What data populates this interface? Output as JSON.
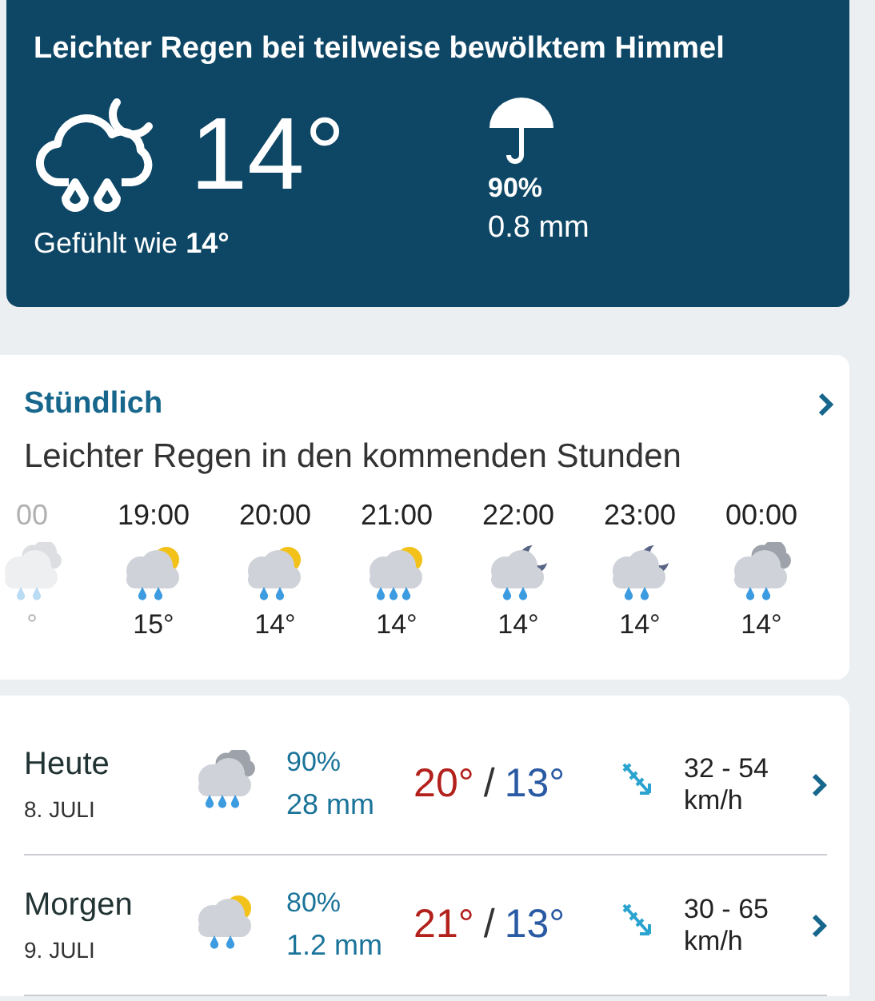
{
  "current": {
    "condition": "Leichter Regen bei teilweise bewölktem Himmel",
    "kind": "moon-rain",
    "temperature": "14°",
    "feels_like_label": "Gefühlt wie",
    "feels_like_value": "14°",
    "precip_chance": "90%",
    "precip_amount": "0.8 mm"
  },
  "hourly": {
    "title": "Stündlich",
    "summary": "Leichter Regen in den kommenden Stunden",
    "hours": [
      {
        "time": "00",
        "kind": "cloud-rain",
        "temp": "°",
        "partial": true
      },
      {
        "time": "19:00",
        "kind": "sun-rain",
        "temp": "15°",
        "partial": false
      },
      {
        "time": "20:00",
        "kind": "sun-rain",
        "temp": "14°",
        "partial": false
      },
      {
        "time": "21:00",
        "kind": "sun-heavy-rain",
        "temp": "14°",
        "partial": false
      },
      {
        "time": "22:00",
        "kind": "moon-rain",
        "temp": "14°",
        "partial": false
      },
      {
        "time": "23:00",
        "kind": "moon-rain",
        "temp": "14°",
        "partial": false
      },
      {
        "time": "00:00",
        "kind": "cloud-rain",
        "temp": "14°",
        "partial": false
      }
    ]
  },
  "days": [
    {
      "day": "Heute",
      "date": "8. JULI",
      "kind": "cloud-heavy-rain",
      "precip_chance": "90%",
      "precip_amount": "28 mm",
      "high": "20°",
      "separator": "/",
      "low": "13°",
      "wind_speed": "32 - 54",
      "wind_unit": "km/h"
    },
    {
      "day": "Morgen",
      "date": "9. JULI",
      "kind": "sun-rain",
      "precip_chance": "80%",
      "precip_amount": "1.2 mm",
      "high": "21°",
      "separator": "/",
      "low": "13°",
      "wind_speed": "30 - 65",
      "wind_unit": "km/h"
    }
  ]
}
